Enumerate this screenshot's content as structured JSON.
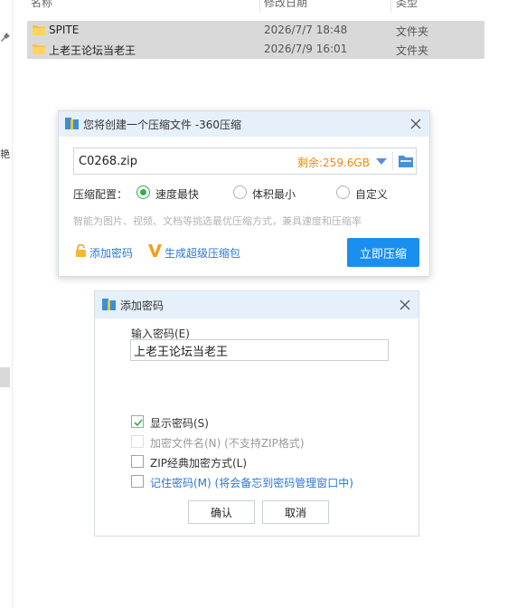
{
  "explorer": {
    "left_strip_char": "艳",
    "columns": {
      "name": "名称",
      "modified": "修改日期",
      "type": "类型"
    },
    "rows": [
      {
        "name": "SPITE",
        "modified": "2026/7/7 18:48",
        "type": "文件夹"
      },
      {
        "name": "上老王论坛当老王",
        "modified": "2026/7/9 16:01",
        "type": "文件夹"
      }
    ]
  },
  "zip_dialog": {
    "title": "您将创建一个压缩文件 -360压缩",
    "path": "C0268.zip",
    "free_space": "剩余:259.6GB",
    "config_label": "压缩配置：",
    "options": [
      {
        "label": "速度最快",
        "checked": true
      },
      {
        "label": "体积最小",
        "checked": false
      },
      {
        "label": "自定义",
        "checked": false
      }
    ],
    "hint": "智能为图片、视频、文档等挑选最优压缩方式，兼具速度和压缩率",
    "add_password_link": "添加密码",
    "super_pack_link": "生成超级压缩包",
    "compress_button": "立即压缩",
    "colors": {
      "accent": "#1a8ff0",
      "free_space": "#f08a00",
      "radio_checked": "#2bb24c",
      "link": "#2a78d8"
    }
  },
  "password_dialog": {
    "title": "添加密码",
    "input_label": "输入密码(E)",
    "password_value": "上老王论坛当老王",
    "checkboxes": [
      {
        "label": "显示密码(S)",
        "checked": true,
        "disabled": false
      },
      {
        "label": "加密文件名(N) (不支持ZIP格式)",
        "checked": false,
        "disabled": true
      },
      {
        "label": "ZIP经典加密方式(L)",
        "checked": false,
        "disabled": false
      },
      {
        "label": "记住密码(M) (将会备忘到密码管理窗口中)",
        "checked": false,
        "disabled": false
      }
    ],
    "ok_button": "确认",
    "cancel_button": "取消"
  }
}
